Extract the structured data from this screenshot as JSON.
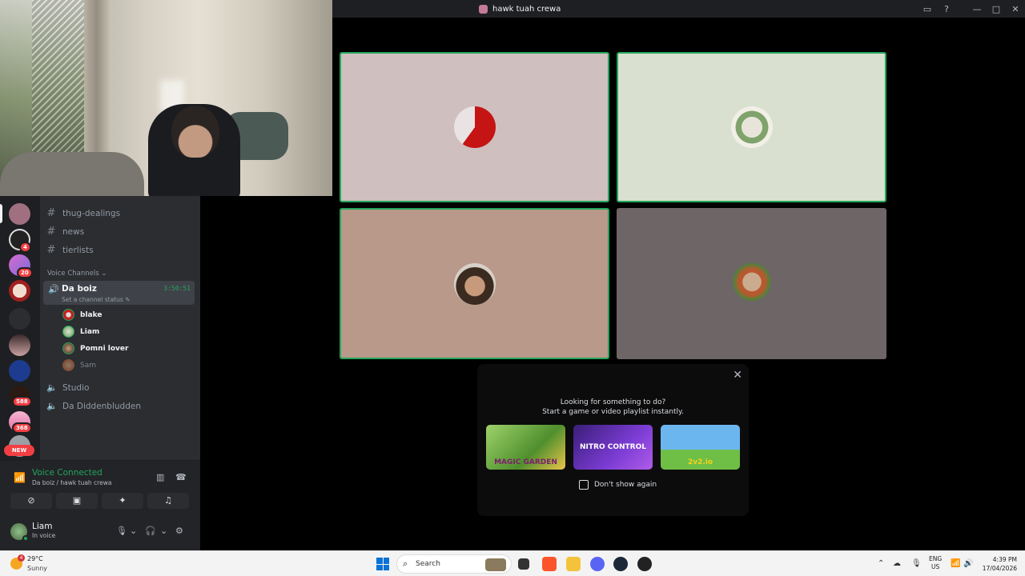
{
  "window": {
    "title": "hawk tuah crewa"
  },
  "channels": {
    "text": [
      "thug-dealings",
      "news",
      "tierlists"
    ],
    "section_label": "Voice Channels",
    "active_voice": {
      "name": "Da boiz",
      "timer": "3:50:51",
      "status_placeholder": "Set a channel status"
    },
    "members": [
      "blake",
      "Liam",
      "Pomni lover",
      "Sam"
    ],
    "other_voice": [
      "Studio",
      "Da Diddenbludden"
    ]
  },
  "servers": {
    "badges": [
      "4",
      "20",
      "588",
      "368"
    ],
    "new_label": "NEW"
  },
  "voice_panel": {
    "status": "Voice Connected",
    "location": "Da boiz / hawk tuah crewa"
  },
  "user": {
    "name": "Liam",
    "status": "In voice"
  },
  "activity_prompt": {
    "line1": "Looking for something to do?",
    "line2": "Start a game or video playlist instantly.",
    "games": [
      "MAGIC GARDEN",
      "NITRO CONTROL",
      "2v2.io"
    ],
    "checkbox_label": "Don't show again"
  },
  "taskbar": {
    "temperature": "29°C",
    "condition": "Sunny",
    "weather_badge": "4",
    "search_label": "Search",
    "lang_line1": "ENG",
    "lang_line2": "US",
    "time": "4:39 PM",
    "date": "17/04/2026"
  },
  "colors": {
    "accent_green": "#23a55a",
    "tile1": "#cfbfbf",
    "tile2": "#d9e0d0",
    "tile3": "#b8998a",
    "tile4": "#6e6566"
  }
}
